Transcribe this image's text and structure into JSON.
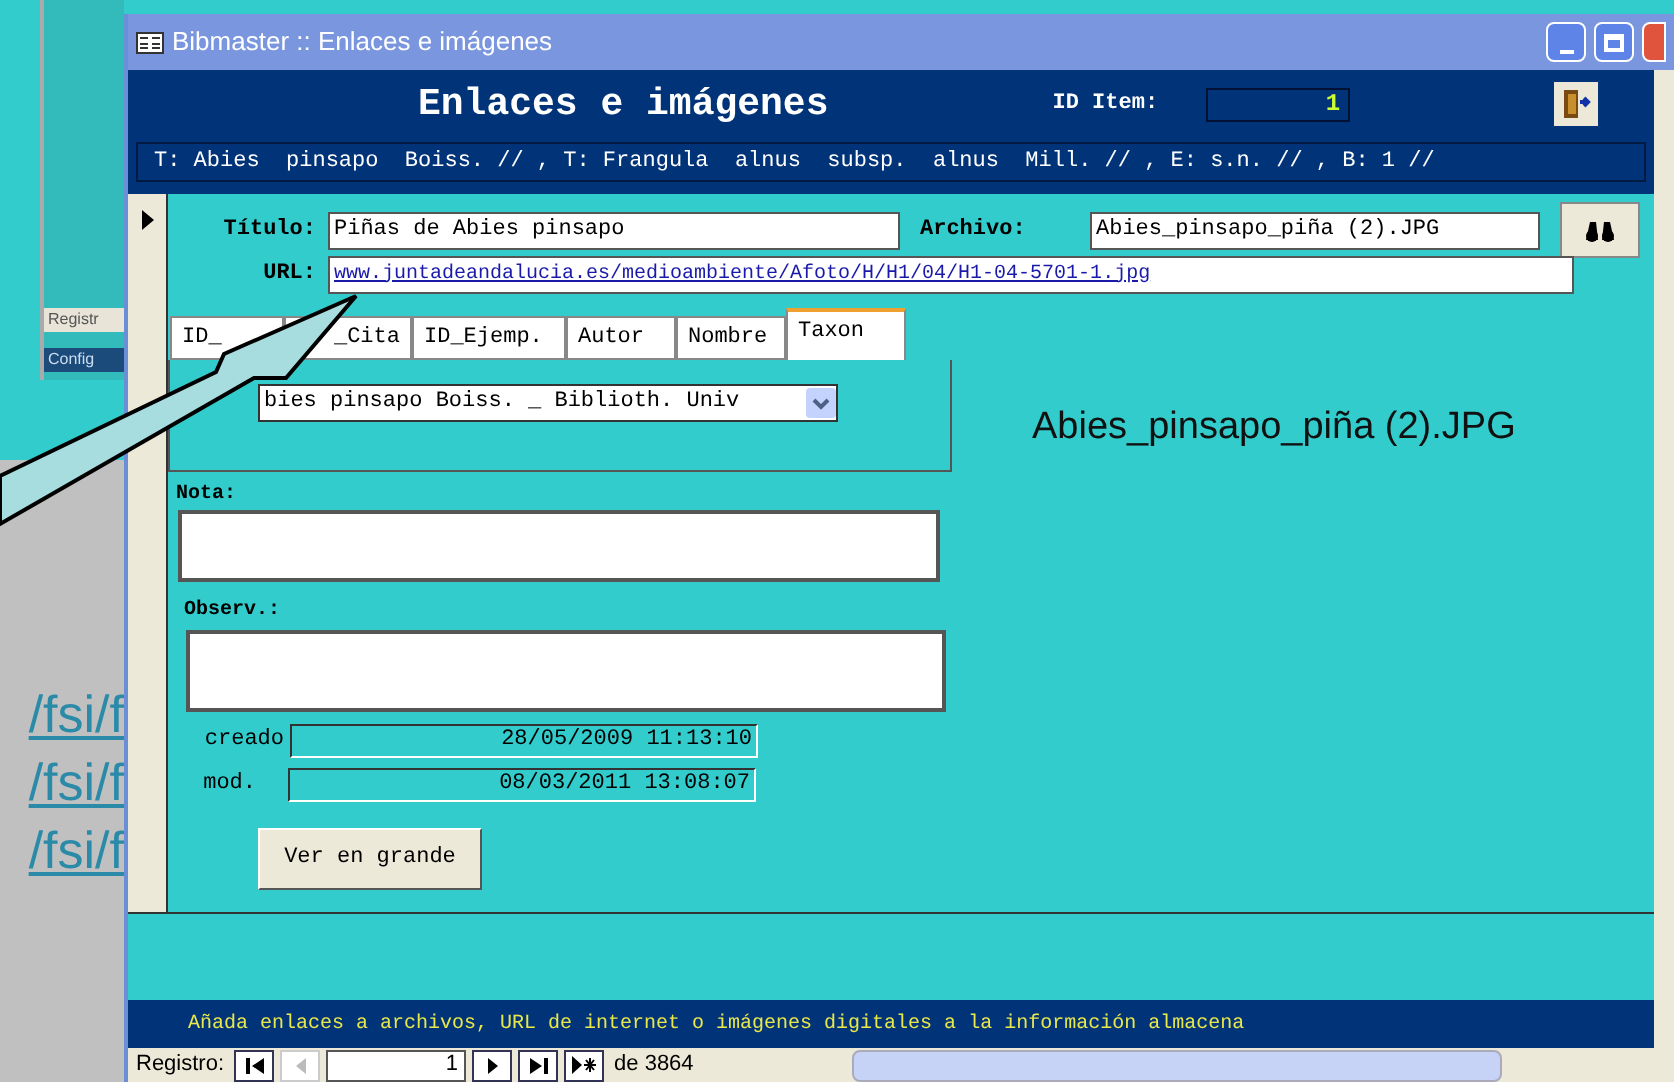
{
  "background": {
    "labels": [
      "Registr",
      "Config"
    ],
    "links": [
      "/fsi/f",
      "/fsi/f",
      "/fsi/f"
    ]
  },
  "window": {
    "title": "Bibmaster :: Enlaces e imágenes"
  },
  "header": {
    "title": "Enlaces e imágenes",
    "id_label": "ID Item:",
    "id_value": "1"
  },
  "summary": "T: Abies  pinsapo  Boiss. // , T: Frangula  alnus  subsp.  alnus  Mill. // , E: s.n. // , B: 1 //",
  "titulo": {
    "label": "Título:",
    "value": "Piñas de Abies pinsapo"
  },
  "archivo": {
    "label": "Archivo:",
    "value": "Abies_pinsapo_piña (2).JPG"
  },
  "url": {
    "label": "URL:",
    "value": "www.juntadeandalucia.es/medioambiente/Afoto/H/H1/04/H1-04-5701-1.jpg"
  },
  "tabs": [
    {
      "label": "ID_",
      "selected": false
    },
    {
      "label": "_Cita",
      "selected": false
    },
    {
      "label": "ID_Ejemp.",
      "selected": false
    },
    {
      "label": "Autor",
      "selected": false
    },
    {
      "label": "Nombre",
      "selected": false
    },
    {
      "label": "Taxon",
      "selected": true
    }
  ],
  "taxon_combo": "bies pinsapo Boiss. _ Biblioth. Univ",
  "nota": {
    "label": "Nota:"
  },
  "observ": {
    "label": "Observ.:"
  },
  "created": {
    "label": "creado",
    "value": "28/05/2009 11:13:10"
  },
  "modified": {
    "label": "mod.",
    "value": "08/03/2011 13:08:07"
  },
  "view_button": "Ver en grande",
  "image_caption": "Abies_pinsapo_piña (2).JPG",
  "status_text": "Añada enlaces a archivos, URL de internet o imágenes digitales a la información almacena",
  "navigator": {
    "label": "Registro:",
    "current": "1",
    "total": "de 3864"
  }
}
